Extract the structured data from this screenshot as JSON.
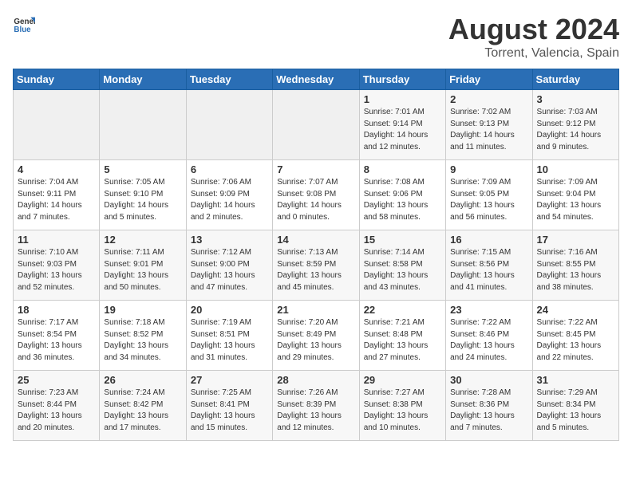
{
  "logo": {
    "general": "General",
    "blue": "Blue"
  },
  "title": {
    "month_year": "August 2024",
    "location": "Torrent, Valencia, Spain"
  },
  "days_of_week": [
    "Sunday",
    "Monday",
    "Tuesday",
    "Wednesday",
    "Thursday",
    "Friday",
    "Saturday"
  ],
  "weeks": [
    [
      {
        "day": "",
        "info": ""
      },
      {
        "day": "",
        "info": ""
      },
      {
        "day": "",
        "info": ""
      },
      {
        "day": "",
        "info": ""
      },
      {
        "day": "1",
        "info": "Sunrise: 7:01 AM\nSunset: 9:14 PM\nDaylight: 14 hours\nand 12 minutes."
      },
      {
        "day": "2",
        "info": "Sunrise: 7:02 AM\nSunset: 9:13 PM\nDaylight: 14 hours\nand 11 minutes."
      },
      {
        "day": "3",
        "info": "Sunrise: 7:03 AM\nSunset: 9:12 PM\nDaylight: 14 hours\nand 9 minutes."
      }
    ],
    [
      {
        "day": "4",
        "info": "Sunrise: 7:04 AM\nSunset: 9:11 PM\nDaylight: 14 hours\nand 7 minutes."
      },
      {
        "day": "5",
        "info": "Sunrise: 7:05 AM\nSunset: 9:10 PM\nDaylight: 14 hours\nand 5 minutes."
      },
      {
        "day": "6",
        "info": "Sunrise: 7:06 AM\nSunset: 9:09 PM\nDaylight: 14 hours\nand 2 minutes."
      },
      {
        "day": "7",
        "info": "Sunrise: 7:07 AM\nSunset: 9:08 PM\nDaylight: 14 hours\nand 0 minutes."
      },
      {
        "day": "8",
        "info": "Sunrise: 7:08 AM\nSunset: 9:06 PM\nDaylight: 13 hours\nand 58 minutes."
      },
      {
        "day": "9",
        "info": "Sunrise: 7:09 AM\nSunset: 9:05 PM\nDaylight: 13 hours\nand 56 minutes."
      },
      {
        "day": "10",
        "info": "Sunrise: 7:09 AM\nSunset: 9:04 PM\nDaylight: 13 hours\nand 54 minutes."
      }
    ],
    [
      {
        "day": "11",
        "info": "Sunrise: 7:10 AM\nSunset: 9:03 PM\nDaylight: 13 hours\nand 52 minutes."
      },
      {
        "day": "12",
        "info": "Sunrise: 7:11 AM\nSunset: 9:01 PM\nDaylight: 13 hours\nand 50 minutes."
      },
      {
        "day": "13",
        "info": "Sunrise: 7:12 AM\nSunset: 9:00 PM\nDaylight: 13 hours\nand 47 minutes."
      },
      {
        "day": "14",
        "info": "Sunrise: 7:13 AM\nSunset: 8:59 PM\nDaylight: 13 hours\nand 45 minutes."
      },
      {
        "day": "15",
        "info": "Sunrise: 7:14 AM\nSunset: 8:58 PM\nDaylight: 13 hours\nand 43 minutes."
      },
      {
        "day": "16",
        "info": "Sunrise: 7:15 AM\nSunset: 8:56 PM\nDaylight: 13 hours\nand 41 minutes."
      },
      {
        "day": "17",
        "info": "Sunrise: 7:16 AM\nSunset: 8:55 PM\nDaylight: 13 hours\nand 38 minutes."
      }
    ],
    [
      {
        "day": "18",
        "info": "Sunrise: 7:17 AM\nSunset: 8:54 PM\nDaylight: 13 hours\nand 36 minutes."
      },
      {
        "day": "19",
        "info": "Sunrise: 7:18 AM\nSunset: 8:52 PM\nDaylight: 13 hours\nand 34 minutes."
      },
      {
        "day": "20",
        "info": "Sunrise: 7:19 AM\nSunset: 8:51 PM\nDaylight: 13 hours\nand 31 minutes."
      },
      {
        "day": "21",
        "info": "Sunrise: 7:20 AM\nSunset: 8:49 PM\nDaylight: 13 hours\nand 29 minutes."
      },
      {
        "day": "22",
        "info": "Sunrise: 7:21 AM\nSunset: 8:48 PM\nDaylight: 13 hours\nand 27 minutes."
      },
      {
        "day": "23",
        "info": "Sunrise: 7:22 AM\nSunset: 8:46 PM\nDaylight: 13 hours\nand 24 minutes."
      },
      {
        "day": "24",
        "info": "Sunrise: 7:22 AM\nSunset: 8:45 PM\nDaylight: 13 hours\nand 22 minutes."
      }
    ],
    [
      {
        "day": "25",
        "info": "Sunrise: 7:23 AM\nSunset: 8:44 PM\nDaylight: 13 hours\nand 20 minutes."
      },
      {
        "day": "26",
        "info": "Sunrise: 7:24 AM\nSunset: 8:42 PM\nDaylight: 13 hours\nand 17 minutes."
      },
      {
        "day": "27",
        "info": "Sunrise: 7:25 AM\nSunset: 8:41 PM\nDaylight: 13 hours\nand 15 minutes."
      },
      {
        "day": "28",
        "info": "Sunrise: 7:26 AM\nSunset: 8:39 PM\nDaylight: 13 hours\nand 12 minutes."
      },
      {
        "day": "29",
        "info": "Sunrise: 7:27 AM\nSunset: 8:38 PM\nDaylight: 13 hours\nand 10 minutes."
      },
      {
        "day": "30",
        "info": "Sunrise: 7:28 AM\nSunset: 8:36 PM\nDaylight: 13 hours\nand 7 minutes."
      },
      {
        "day": "31",
        "info": "Sunrise: 7:29 AM\nSunset: 8:34 PM\nDaylight: 13 hours\nand 5 minutes."
      }
    ]
  ]
}
